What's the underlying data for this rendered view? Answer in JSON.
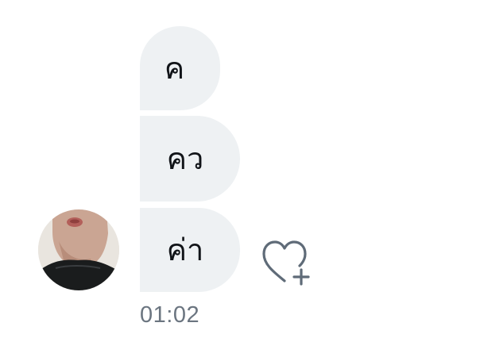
{
  "messages": [
    {
      "text": "ค"
    },
    {
      "text": "คว"
    },
    {
      "text": "ค่า"
    }
  ],
  "timestamp": "01:02",
  "colors": {
    "bubble_bg": "#eef1f3",
    "text": "#111418",
    "icon": "#5f6b78",
    "timestamp": "#6b7580"
  },
  "icons": {
    "react": "heart-plus-icon",
    "avatar": "user-photo"
  }
}
